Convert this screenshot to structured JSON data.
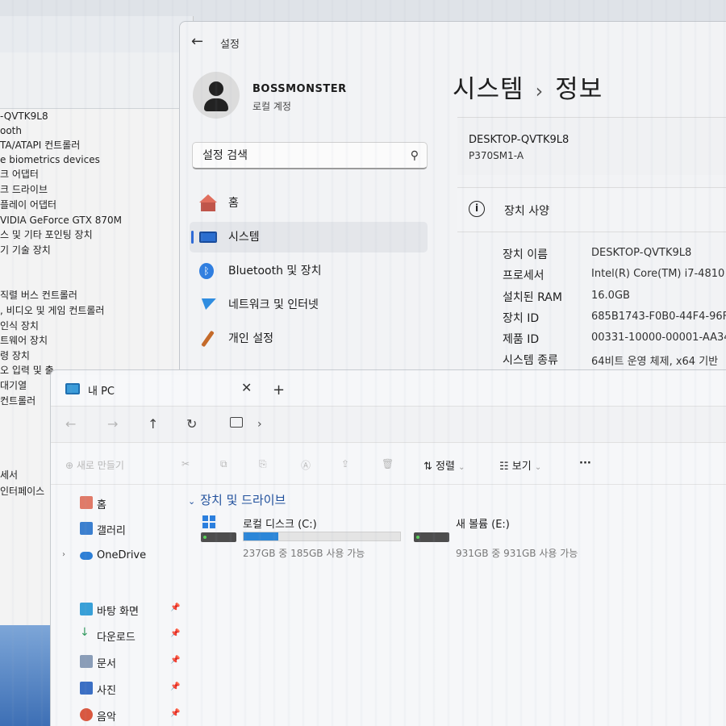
{
  "device_manager": {
    "rows": [
      "-QVTK9L8",
      "ooth",
      "TA/ATAPI 컨트롤러",
      "e biometrics devices",
      "크 어댑터",
      "크 드라이브",
      "플레이 어댑터",
      "VIDIA GeForce GTX 870M",
      "스 및 기타 포인팅 장치",
      "기 기술 장치",
      "",
      "직렬 버스 컨트롤러",
      ", 비디오 및 게임 컨트롤러",
      "인식 장치",
      "트웨어 장치",
      "령 장치",
      "오 입력 및 출",
      "대기열",
      "컨트롤러",
      "",
      "",
      "",
      "",
      "세서",
      "인터페이스"
    ]
  },
  "settings": {
    "app_title": "설정",
    "profile": {
      "name": "BOSSMONSTER",
      "subtitle": "로컬 계정"
    },
    "search_placeholder": "설정 검색",
    "nav": [
      {
        "label": "홈",
        "icon": "home-icon"
      },
      {
        "label": "시스템",
        "icon": "system-icon",
        "active": true
      },
      {
        "label": "Bluetooth 및 장치",
        "icon": "bluetooth-icon"
      },
      {
        "label": "네트워크 및 인터넷",
        "icon": "network-icon"
      },
      {
        "label": "개인 설정",
        "icon": "personalize-icon"
      }
    ],
    "breadcrumb": {
      "parent": "시스템",
      "separator": "›",
      "current": "정보"
    },
    "device_card": {
      "hostname": "DESKTOP-QVTK9L8",
      "model": "P370SM1-A"
    },
    "spec_section_title": "장치 사양",
    "specs": [
      {
        "label": "장치 이름",
        "value": "DESKTOP-QVTK9L8"
      },
      {
        "label": "프로세서",
        "value": "Intel(R) Core(TM) i7-4810"
      },
      {
        "label": "설치된 RAM",
        "value": "16.0GB"
      },
      {
        "label": "장치 ID",
        "value": "685B1743-F0B0-44F4-96F"
      },
      {
        "label": "제품 ID",
        "value": "00331-10000-00001-AA34"
      },
      {
        "label": "시스템 종류",
        "value": "64비트 운영 체제, x64 기반"
      }
    ]
  },
  "explorer": {
    "tab_title": "내 PC",
    "toolbar": {
      "new_label": "새로 만들기",
      "sort_label": "정렬",
      "view_label": "보기",
      "more_label": "···"
    },
    "nav": [
      {
        "label": "홈",
        "icon": "home-icon"
      },
      {
        "label": "갤러리",
        "icon": "gallery-icon"
      },
      {
        "label": "OneDrive",
        "icon": "onedrive-icon"
      },
      {
        "label": "바탕 화면",
        "icon": "desktop-icon",
        "pinned": true
      },
      {
        "label": "다운로드",
        "icon": "download-icon",
        "pinned": true
      },
      {
        "label": "문서",
        "icon": "documents-icon",
        "pinned": true
      },
      {
        "label": "사진",
        "icon": "pictures-icon",
        "pinned": true
      },
      {
        "label": "음악",
        "icon": "music-icon",
        "pinned": true
      }
    ],
    "section_title": "장치 및 드라이브",
    "drives": [
      {
        "name": "로컬 디스크 (C:)",
        "free_text": "237GB 중 185GB 사용 가능",
        "used_fraction": 0.22
      },
      {
        "name": "새 볼륨 (E:)",
        "free_text": "931GB 중 931GB 사용 가능",
        "used_fraction": 0.0
      }
    ]
  },
  "colors": {
    "accent": "#2b6ecf",
    "drive_bar": "#2b86d8",
    "section_title": "#1f4f9c"
  }
}
